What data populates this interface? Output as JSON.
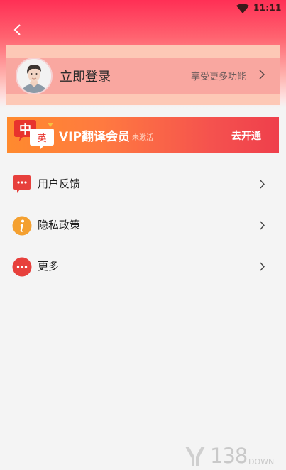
{
  "status_bar": {
    "time": "11:11",
    "wifi_icon": "wifi-icon"
  },
  "header": {
    "back_icon": "chevron-left-icon",
    "gradient_top": "#ff2f55"
  },
  "login": {
    "title": "立即登录",
    "hint": "享受更多功能",
    "avatar_icon": "avatar-icon"
  },
  "vip": {
    "logo_top": "中",
    "logo_bottom": "英",
    "title": "VIP翻译会员",
    "status": "未激活",
    "action": "去开通",
    "gradient_from": "#ff8a2e",
    "gradient_to": "#ef3f4c"
  },
  "menu": {
    "items": [
      {
        "label": "用户反馈",
        "icon": "feedback-icon",
        "color": "#e7403c"
      },
      {
        "label": "隐私政策",
        "icon": "info-icon",
        "color": "#f4a030"
      },
      {
        "label": "更多",
        "icon": "more-icon",
        "color": "#e7403c"
      }
    ]
  },
  "watermark": {
    "brand": "138",
    "sub": "DOWN"
  }
}
